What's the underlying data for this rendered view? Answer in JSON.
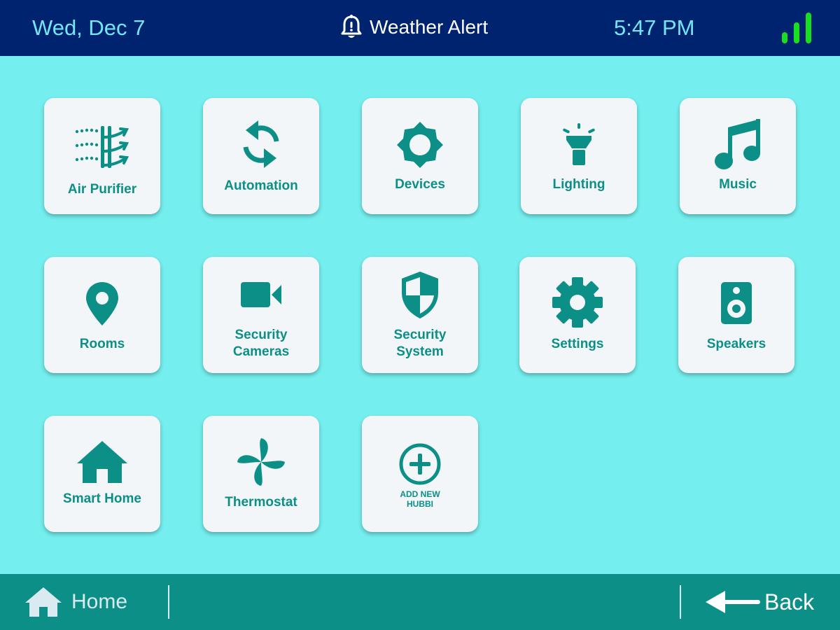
{
  "status_bar": {
    "date": "Wed, Dec 7",
    "alert": {
      "icon": "bell-alert-icon",
      "label": "Weather Alert"
    },
    "time": "5:47 PM",
    "signal": {
      "icon": "signal-strength-icon",
      "color": "#18E020"
    }
  },
  "tiles": [
    {
      "label": "Air Purifier",
      "icon": "air-purifier-icon"
    },
    {
      "label": "Automation",
      "icon": "sync-arrows-icon"
    },
    {
      "label": "Devices",
      "icon": "devices-gear-icon"
    },
    {
      "label": "Lighting",
      "icon": "flashlight-icon"
    },
    {
      "label": "Music",
      "icon": "music-note-icon"
    },
    {
      "label": "Rooms",
      "icon": "map-pin-icon"
    },
    {
      "label": "Security\nCameras",
      "icon": "video-camera-icon"
    },
    {
      "label": "Security\nSystem",
      "icon": "shield-icon"
    },
    {
      "label": "Settings",
      "icon": "settings-gear-icon"
    },
    {
      "label": "Speakers",
      "icon": "speaker-icon"
    },
    {
      "label": "Smart Home",
      "icon": "house-icon"
    },
    {
      "label": "Thermostat",
      "icon": "fan-icon"
    },
    {
      "label": "ADD NEW\nHUBBI",
      "icon": "add-circle-icon"
    }
  ],
  "bottom_bar": {
    "home": {
      "label": "Home",
      "icon": "home-icon"
    },
    "back": {
      "label": "Back",
      "icon": "arrow-left-icon"
    }
  },
  "colors": {
    "background": "#74EEEE",
    "top_bar": "#00236F",
    "bottom_bar": "#0B8F87",
    "accent_teal": "#0B8F87",
    "tile": "#F2F6F8"
  }
}
